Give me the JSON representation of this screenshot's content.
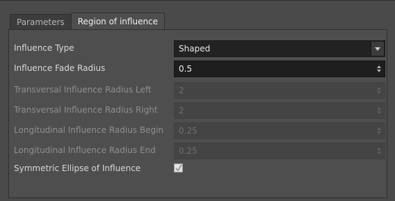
{
  "tabs": [
    {
      "label": "Parameters",
      "active": false
    },
    {
      "label": "Region of influence",
      "active": true
    }
  ],
  "fields": {
    "influence_type": {
      "label": "Influence Type",
      "value": "Shaped",
      "enabled": true
    },
    "influence_fade_radius": {
      "label": "Influence Fade Radius",
      "value": "0.5",
      "enabled": true
    },
    "transversal_left": {
      "label": "Transversal Influence Radius Left",
      "value": "2",
      "enabled": false
    },
    "transversal_right": {
      "label": "Transversal Influence Radius Right",
      "value": "2",
      "enabled": false
    },
    "longitudinal_begin": {
      "label": "Longitudinal Influence Radius Begin",
      "value": "0.25",
      "enabled": false
    },
    "longitudinal_end": {
      "label": "Longitudinal Influence Radius End",
      "value": "0.25",
      "enabled": false
    },
    "symmetric_ellipse": {
      "label": "Symmetric Ellipse of Influence",
      "checked": true,
      "enabled": false
    }
  },
  "colors": {
    "background": "#4a4a4a",
    "panel": "#4e4e4e",
    "field_dark": "#1e1e1e"
  }
}
